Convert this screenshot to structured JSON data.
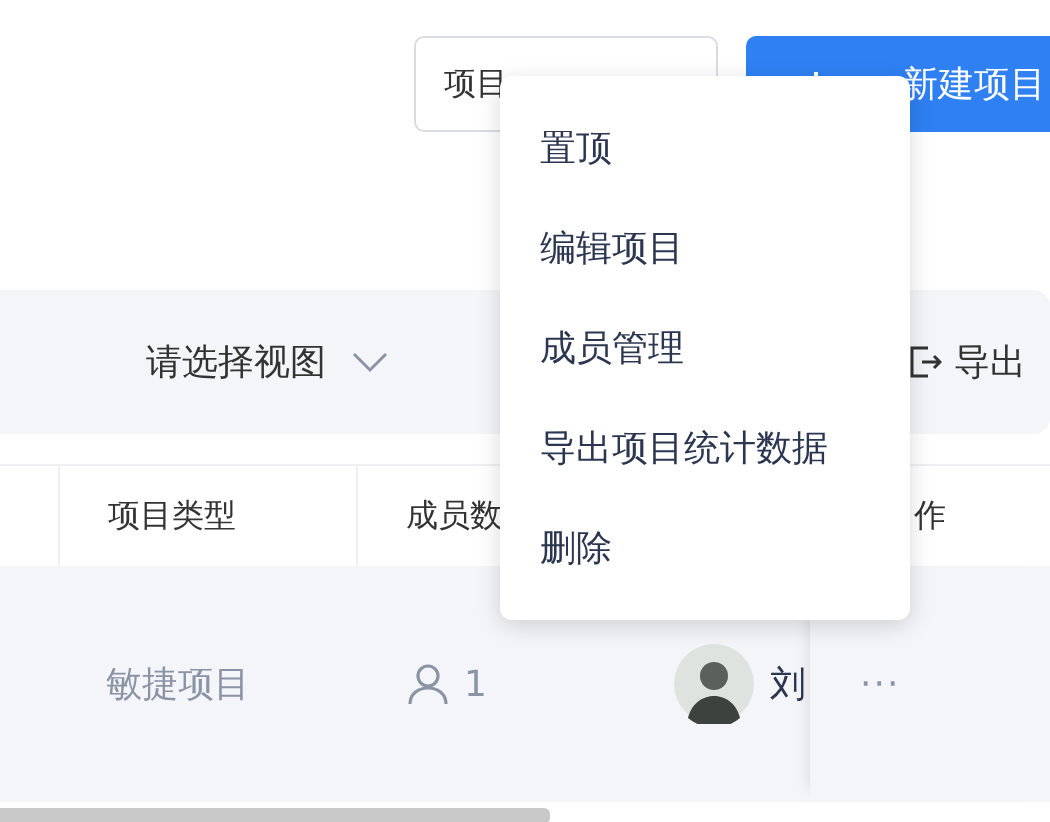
{
  "header_buttons": [
    {
      "kind": "outline",
      "label": "项目"
    },
    {
      "kind": "primary",
      "label": "新建项目"
    }
  ],
  "toolbar": {
    "view_select": {
      "placeholder": "请选择视图"
    },
    "export": {
      "label": "导出"
    }
  },
  "table": {
    "columns": [
      "",
      "项目类型",
      "成员数",
      "",
      "作"
    ],
    "rows": [
      {
        "type": "敏捷项目",
        "members": "1",
        "owner": "刘",
        "actions": "···"
      }
    ]
  },
  "context_menu": {
    "items": [
      {
        "label": "置顶"
      },
      {
        "label": "编辑项目"
      },
      {
        "label": "成员管理"
      },
      {
        "label": "导出项目统计数据"
      },
      {
        "label": "删除"
      }
    ]
  }
}
